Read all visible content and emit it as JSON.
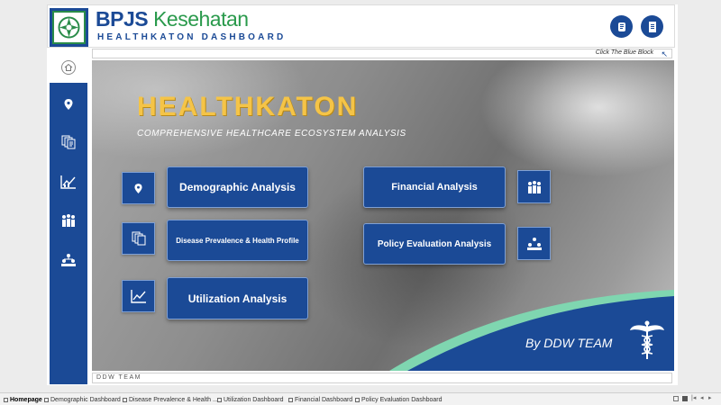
{
  "header": {
    "brand": "BPJS",
    "brand_suffix": "Kesehatan",
    "subtitle": "HEALTHKATON DASHBOARD",
    "hint": "Click The Blue Block"
  },
  "sidebar": {
    "items": [
      {
        "icon": "home-icon"
      },
      {
        "icon": "location-pin-icon"
      },
      {
        "icon": "documents-icon"
      },
      {
        "icon": "chart-icon"
      },
      {
        "icon": "people-group-icon"
      },
      {
        "icon": "hierarchy-icon"
      }
    ]
  },
  "hero": {
    "title": "HEALTHKATON",
    "subtitle": "COMPREHENSIVE HEALTHCARE ECOSYSTEM ANALYSIS",
    "team": "By DDW TEAM"
  },
  "nav": {
    "demographic": "Demographic Analysis",
    "disease": "Disease Prevalence & Health Profile",
    "utilization": "Utilization Analysis",
    "financial": "Financial Analysis",
    "policy": "Policy Evaluation Analysis"
  },
  "footer": {
    "text": "DDW TEAM"
  },
  "tabs": [
    "Homepage",
    "Demographic Dashboard",
    "Disease Prevalence & Health ...",
    "Utilization Dashboard",
    "Financial Dashboard",
    "Policy Evaluation Dashboard"
  ],
  "colors": {
    "primary": "#1b4a96",
    "accent_green": "#2a9a4c",
    "title_gold": "#f5c447",
    "wave_mint": "#7fd6b0"
  }
}
